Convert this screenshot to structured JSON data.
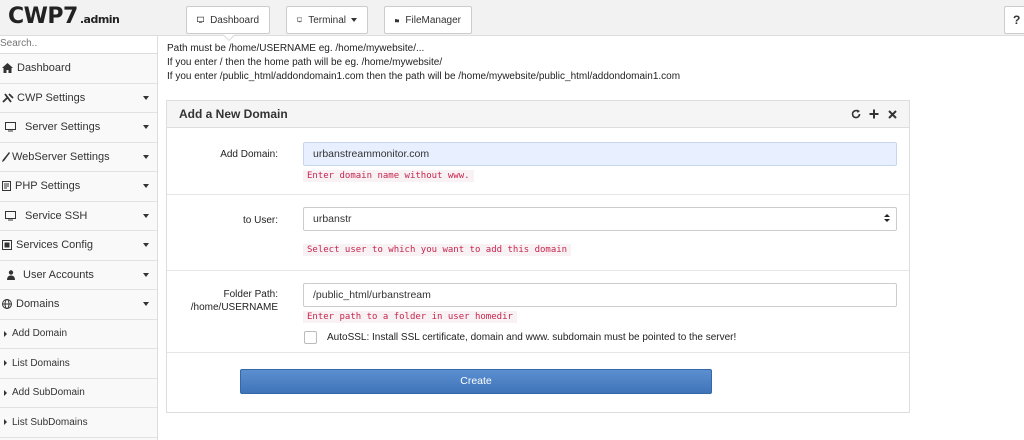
{
  "header": {
    "logo": "CWP7",
    "logo_sub": ".admin",
    "nav": {
      "dashboard": "Dashboard",
      "terminal": "Terminal",
      "filemanager": "FileManager"
    },
    "help": "?"
  },
  "sidebar": {
    "search_placeholder": "Search..",
    "items": [
      {
        "label": "Dashboard",
        "icon": "home-icon"
      },
      {
        "label": "CWP Settings",
        "icon": "wrench-icon"
      },
      {
        "label": "Server Settings",
        "icon": "monitor-icon"
      },
      {
        "label": "WebServer Settings",
        "icon": "pencil-icon"
      },
      {
        "label": "PHP Settings",
        "icon": "php-icon"
      },
      {
        "label": "Service SSH",
        "icon": "monitor-icon"
      },
      {
        "label": "Services Config",
        "icon": "services-icon"
      },
      {
        "label": "User Accounts",
        "icon": "user-icon"
      },
      {
        "label": "Domains",
        "icon": "globe-icon"
      }
    ],
    "subitems": [
      "Add Domain",
      "List Domains",
      "Add SubDomain",
      "List SubDomains"
    ]
  },
  "info": {
    "line1": "Path must be /home/USERNAME eg. /home/mywebsite/...",
    "line2": "If you enter / then the home path will be eg. /home/mywebsite/",
    "line3": "If you enter /public_html/addondomain1.com then the path will be /home/mywebsite/public_html/addondomain1.com"
  },
  "panel": {
    "title": "Add a New Domain",
    "domain_label": "Add Domain:",
    "domain_value": "urbanstreammonitor.com",
    "domain_help": "Enter domain name without www.",
    "user_label": "to User:",
    "user_value": "urbanstr",
    "user_help": "Select user to which you want to add this domain",
    "folder_label_1": "Folder Path:",
    "folder_label_2": "/home/USERNAME",
    "folder_value": "/public_html/urbanstream",
    "folder_help": "Enter path to a folder in user homedir",
    "autossl_label": "AutoSSL: Install SSL certificate, domain and www. subdomain must be pointed to the server!",
    "create_label": "Create"
  }
}
